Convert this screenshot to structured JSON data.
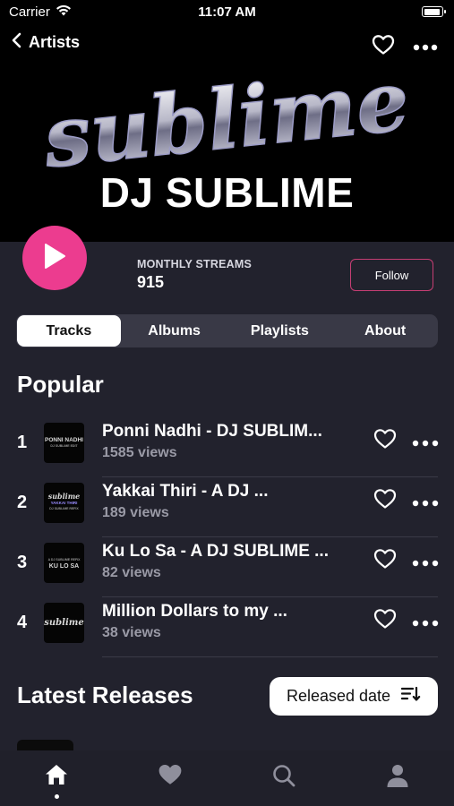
{
  "status": {
    "carrier": "Carrier",
    "time": "11:07 AM"
  },
  "nav": {
    "back_label": "Artists"
  },
  "artist": {
    "logo_text": "sublime",
    "name": "DJ SUBLIME",
    "monthly_streams_label": "MONTHLY STREAMS",
    "monthly_streams_value": "915",
    "follow_label": "Follow"
  },
  "tabs": [
    {
      "label": "Tracks",
      "active": true
    },
    {
      "label": "Albums",
      "active": false
    },
    {
      "label": "Playlists",
      "active": false
    },
    {
      "label": "About",
      "active": false
    }
  ],
  "popular": {
    "title": "Popular",
    "tracks": [
      {
        "rank": "1",
        "title": "Ponni Nadhi - DJ SUBLIM...",
        "views": "1585 views",
        "thumb_lines": [
          "PONNI NADHI",
          "DJ SUBLIME EDIT"
        ]
      },
      {
        "rank": "2",
        "title": "Yakkai Thiri - A DJ ...",
        "views": "189 views",
        "thumb_lines": [
          "sublime",
          "YAKKAI THIRI",
          "DJ SUBLIME REFIX"
        ]
      },
      {
        "rank": "3",
        "title": "Ku Lo Sa - A DJ SUBLIME ...",
        "views": "82 views",
        "thumb_lines": [
          "A DJ SUBLIME REFIX",
          "KU LO SA"
        ]
      },
      {
        "rank": "4",
        "title": "Million Dollars to my ...",
        "views": "38 views",
        "thumb_lines": [
          "sublime"
        ]
      }
    ]
  },
  "latest": {
    "title": "Latest Releases",
    "sort_label": "Released date"
  },
  "tabbar": [
    {
      "icon": "home-icon",
      "active": true
    },
    {
      "icon": "heart-icon",
      "active": false
    },
    {
      "icon": "search-icon",
      "active": false
    },
    {
      "icon": "person-icon",
      "active": false
    }
  ],
  "colors": {
    "accent": "#ec3c8f",
    "background": "#22222d",
    "hero": "#000000",
    "follow_border": "#c53e73"
  }
}
